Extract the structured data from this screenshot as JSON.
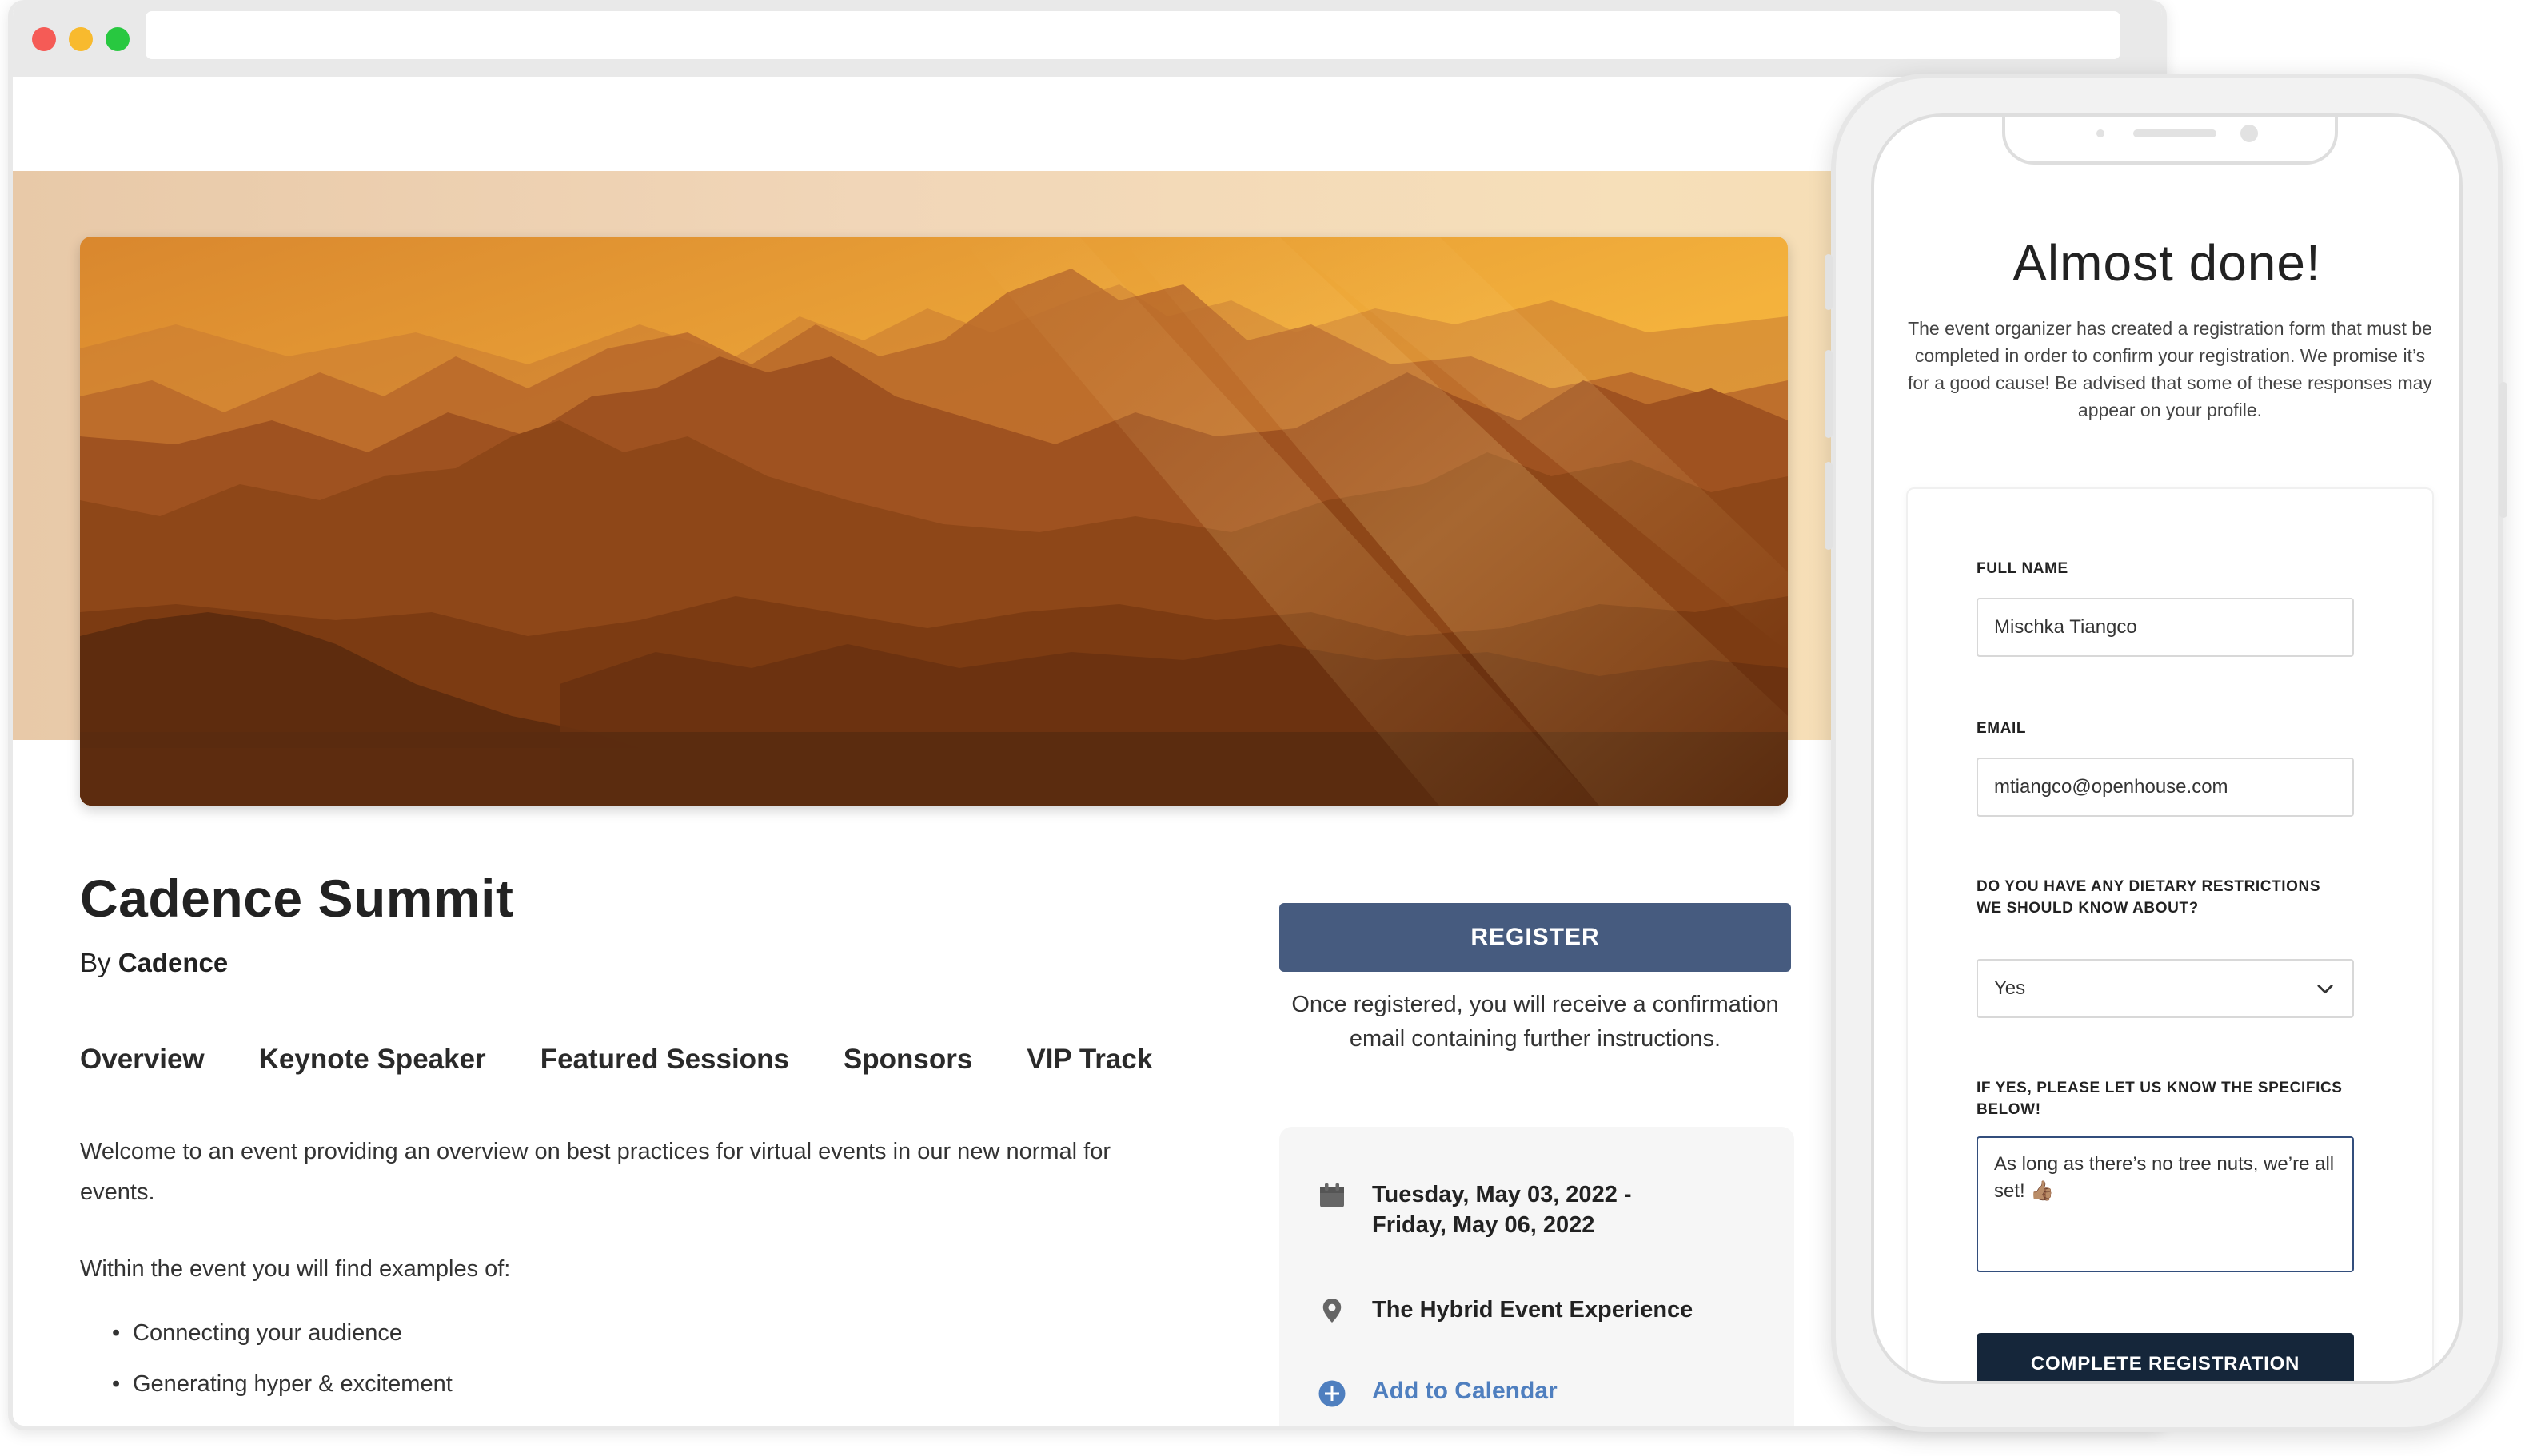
{
  "event": {
    "title": "Cadence Summit",
    "by_prefix": "By",
    "organizer": "Cadence",
    "tabs": [
      "Overview",
      "Keynote Speaker",
      "Featured Sessions",
      "Sponsors",
      "VIP Track"
    ],
    "description": "Welcome to an event providing an overview on best practices for virtual events in our new normal for events.",
    "within_heading": "Within the event you will find examples of:",
    "bullets": [
      "Connecting your audience",
      "Generating hyper & excitement"
    ]
  },
  "register": {
    "button_label": "REGISTER",
    "note": "Once registered, you will receive a confirmation email containing further instructions."
  },
  "info": {
    "date_line1": "Tuesday, May 03, 2022 -",
    "date_line2": "Friday, May 06, 2022",
    "location": "The Hybrid Event Experience",
    "calendar_link": "Add to Calendar",
    "icons": [
      "calendar-icon",
      "location-pin-icon",
      "plus-circle-icon"
    ]
  },
  "phone_form": {
    "heading": "Almost done!",
    "intro": "The event organizer has created a registration form that must be completed in order to confirm your registration. We promise it’s for a good cause! Be advised that some of these responses may appear on your profile.",
    "full_name_label": "FULL NAME",
    "full_name_value": "Mischka Tiangco",
    "email_label": "EMAIL",
    "email_value": "mtiangco@openhouse.com",
    "dietary_label": "DO YOU HAVE ANY DIETARY RESTRICTIONS WE SHOULD KNOW ABOUT?",
    "dietary_value": "Yes",
    "specifics_label": "IF YES, PLEASE LET US KNOW THE SPECIFICS BELOW!",
    "specifics_value": "As long as there’s no tree nuts, we’re all set! 👍🏽",
    "submit_label": "COMPLETE REGISTRATION"
  },
  "colors": {
    "register_button": "#465b7f",
    "complete_button": "#15263a",
    "link": "#4f7fbf",
    "info_card_bg": "#f6f6f6"
  }
}
